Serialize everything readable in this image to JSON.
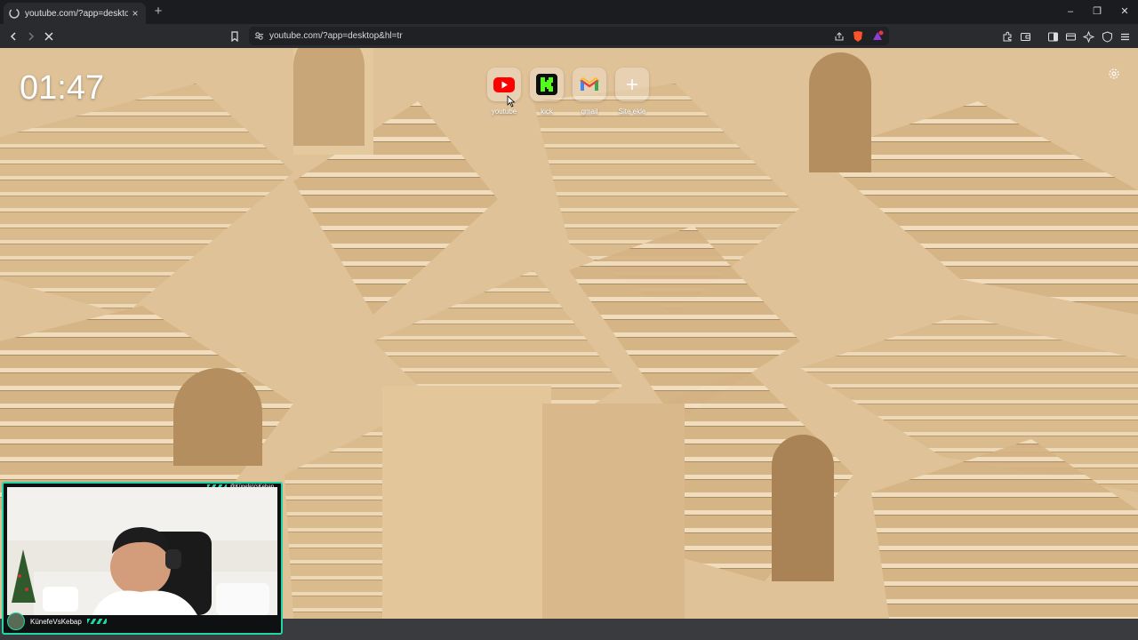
{
  "tab": {
    "title": "youtube.com/?app=desktop&hl",
    "close_glyph": "×",
    "new_tab_glyph": "+"
  },
  "window_controls": {
    "minimize": "–",
    "maximize": "❐",
    "close": "✕"
  },
  "address_bar": {
    "url": "youtube.com/?app=desktop&hl=tr"
  },
  "newtab_page": {
    "clock": "01:47",
    "top_sites": [
      {
        "label": "youtube",
        "icon": "youtube-icon"
      },
      {
        "label": "kick",
        "icon": "kick-icon"
      },
      {
        "label": "gmail",
        "icon": "gmail-icon"
      },
      {
        "label": "Site ekle",
        "icon": "plus-icon"
      }
    ]
  },
  "webcam": {
    "handle_top": "@KünefeVsKebap",
    "channel_name": "KünefeVsKebap"
  },
  "colors": {
    "accent": "#1fd6a4",
    "youtube_red": "#ff0000",
    "kick_green": "#53fc18",
    "brave_orange": "#fb542b"
  }
}
